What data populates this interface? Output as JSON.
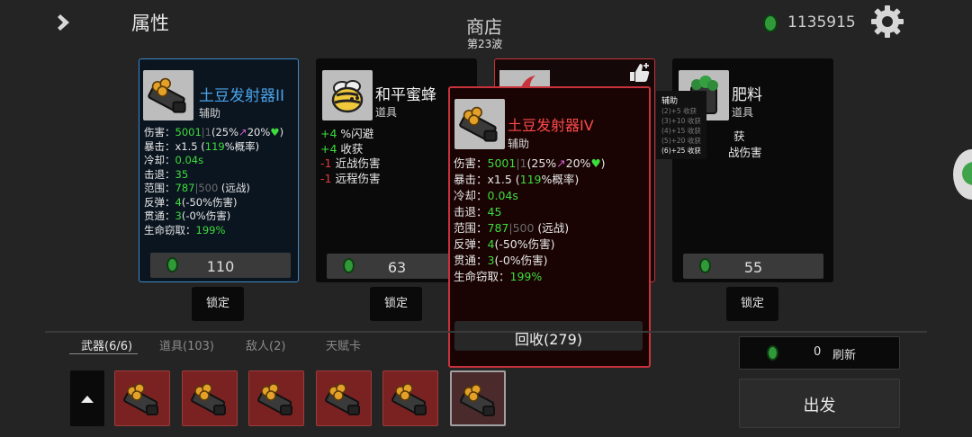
{
  "header": {
    "tab_title": "属性",
    "shop_title": "商店",
    "wave": "第23波",
    "coins": "1135915"
  },
  "cards": [
    {
      "name": "土豆发射器II",
      "type": "辅助",
      "stats": [
        {
          "label": "伤害：",
          "parts": [
            [
              "5001",
              "g"
            ],
            [
              "|",
              "dim"
            ],
            [
              "1",
              "dim"
            ],
            [
              "(25%",
              ""
            ],
            [
              "↗",
              "pink"
            ],
            [
              "20%",
              ""
            ],
            [
              "♥",
              "g"
            ],
            [
              ")",
              ""
            ]
          ]
        },
        {
          "label": "暴击：",
          "parts": [
            [
              "x1.5 (",
              ""
            ],
            [
              "119",
              "g"
            ],
            [
              "%概率)",
              ""
            ]
          ]
        },
        {
          "label": "冷却：",
          "parts": [
            [
              "0.04s",
              "g"
            ]
          ]
        },
        {
          "label": "击退：",
          "parts": [
            [
              "35",
              "g"
            ]
          ]
        },
        {
          "label": "范围：",
          "parts": [
            [
              "787",
              "g"
            ],
            [
              "|",
              "dim"
            ],
            [
              "500",
              "dim"
            ],
            [
              " (远战)",
              ""
            ]
          ]
        },
        {
          "label": "反弹：",
          "parts": [
            [
              "4",
              "g"
            ],
            [
              "(-50%伤害)",
              ""
            ]
          ]
        },
        {
          "label": "贯通：",
          "parts": [
            [
              "3",
              "g"
            ],
            [
              "(-0%伤害)",
              ""
            ]
          ]
        },
        {
          "label": "生命窃取：",
          "parts": [
            [
              "199%",
              "g"
            ]
          ]
        }
      ],
      "price": "110",
      "lock": "锁定"
    },
    {
      "name": "和平蜜蜂",
      "type": "道具",
      "effects": [
        {
          "value": "+4",
          "text": " %闪避",
          "kind": "g"
        },
        {
          "value": "+4",
          "text": " 收获",
          "kind": "g"
        },
        {
          "value": "-1",
          "text": " 近战伤害",
          "kind": "red"
        },
        {
          "value": "-1",
          "text": " 远程伤害",
          "kind": "red"
        }
      ],
      "price": "63",
      "lock": "锁定"
    },
    {
      "name": "肥料",
      "type": "道具",
      "partial_lines": [
        "获",
        "战伤害"
      ],
      "price": "55",
      "lock": "锁定"
    }
  ],
  "popup": {
    "name": "土豆发射器IV",
    "type": "辅助",
    "stats": [
      {
        "label": "伤害：",
        "parts": [
          [
            "5001",
            "g"
          ],
          [
            "|",
            "dim"
          ],
          [
            "1",
            "dim"
          ],
          [
            "(25%",
            ""
          ],
          [
            "↗",
            "pink"
          ],
          [
            "20%",
            ""
          ],
          [
            "♥",
            "g"
          ],
          [
            ")",
            ""
          ]
        ]
      },
      {
        "label": "暴击：",
        "parts": [
          [
            "x1.5 (",
            ""
          ],
          [
            "119",
            "g"
          ],
          [
            "%概率)",
            ""
          ]
        ]
      },
      {
        "label": "冷却：",
        "parts": [
          [
            "0.04s",
            "g"
          ]
        ]
      },
      {
        "label": "击退：",
        "parts": [
          [
            "45",
            "g"
          ]
        ]
      },
      {
        "label": "范围：",
        "parts": [
          [
            "787",
            "g"
          ],
          [
            "|",
            "dim"
          ],
          [
            "500",
            "dim"
          ],
          [
            " (远战)",
            ""
          ]
        ]
      },
      {
        "label": "反弹：",
        "parts": [
          [
            "4",
            "g"
          ],
          [
            "(-50%伤害)",
            ""
          ]
        ]
      },
      {
        "label": "贯通：",
        "parts": [
          [
            "3",
            "g"
          ],
          [
            "(-0%伤害)",
            ""
          ]
        ]
      },
      {
        "label": "生命窃取：",
        "parts": [
          [
            "199%",
            "g"
          ]
        ]
      }
    ],
    "recycle_label": "回收(279)"
  },
  "set_tooltip": {
    "title": "辅助",
    "lines": [
      "(2)+5 收获",
      "(3)+10 收获",
      "(4)+15 收获",
      "(5)+20 收获",
      "(6)+25 收获"
    ]
  },
  "bottom_tabs": [
    "武器(6/6)",
    "道具(103)",
    "敌人(2)",
    "天赋卡"
  ],
  "refresh": {
    "cost": "0",
    "label": "刷新"
  },
  "go_label": "出发",
  "colors": {
    "accent_blue": "#3d89c9",
    "accent_red": "#c8323a",
    "coin_green": "#2f9a37",
    "stat_green": "#3ddc3d"
  }
}
